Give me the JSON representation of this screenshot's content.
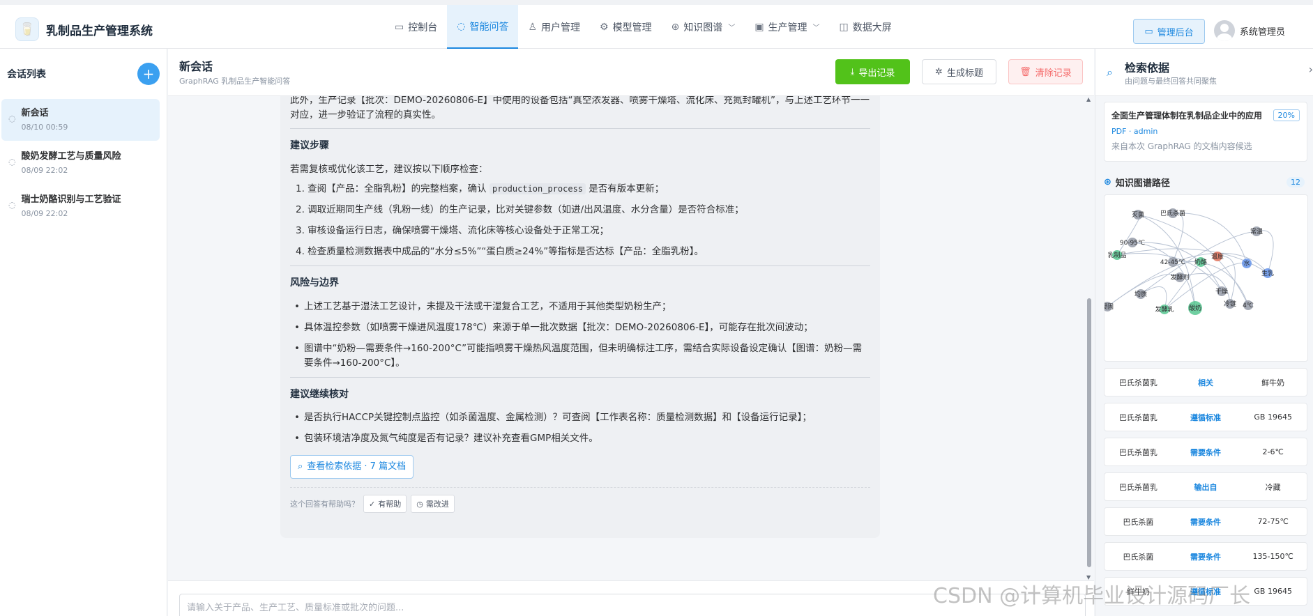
{
  "brand": {
    "name": "乳制品生产管理系统"
  },
  "nav": [
    {
      "label": "控制台",
      "icon": "monitor-icon",
      "glyph": "▭"
    },
    {
      "label": "智能问答",
      "icon": "chat-icon",
      "glyph": "◌",
      "active": true
    },
    {
      "label": "用户管理",
      "icon": "user-icon",
      "glyph": "♙"
    },
    {
      "label": "模型管理",
      "icon": "gear-icon",
      "glyph": "⚙"
    },
    {
      "label": "知识图谱",
      "icon": "graph-icon",
      "glyph": "⊛",
      "dropdown": true
    },
    {
      "label": "生产管理",
      "icon": "factory-icon",
      "glyph": "▣",
      "dropdown": true
    },
    {
      "label": "数据大屏",
      "icon": "dashboard-icon",
      "glyph": "◫"
    }
  ],
  "header": {
    "admin_label": "管理后台",
    "user_name": "系统管理员"
  },
  "sidebar": {
    "title": "会话列表",
    "add": "+",
    "sessions": [
      {
        "title": "新会话",
        "date": "08/10 00:59",
        "active": true
      },
      {
        "title": "酸奶发酵工艺与质量风险",
        "date": "08/09 22:02"
      },
      {
        "title": "瑞士奶酪识别与工艺验证",
        "date": "08/09 22:02"
      }
    ]
  },
  "main": {
    "title": "新会话",
    "subtitle": "GraphRAG 乳制品生产智能问答",
    "export_label": "导出记录",
    "gen_title_label": "生成标题",
    "clear_label": "清除记录",
    "input_placeholder": "请输入关于产品、生产工艺、质量标准或批次的问题..."
  },
  "answer": {
    "top_paragraph": "此外，生产记录【批次：DEMO-20260806-E】中使用的设备包括“真空浓发器、喷雾干燥塔、流化床、充氮封罐机”，与上述工艺环节一一对应，进一步验证了流程的真实性。",
    "sec1_title": "建议步骤",
    "sec1_intro": "若需复核或优化该工艺，建议按以下顺序检查：",
    "step1_prefix": "1. 查阅【产品：全脂乳粉】的完整档案，确认 ",
    "step1_code": "production_process",
    "step1_suffix": " 是否有版本更新；",
    "step2": "2. 调取近期同生产线（乳粉一线）的生产记录，比对关键参数（如进/出风温度、水分含量）是否符合标准；",
    "step3": "3. 审核设备运行日志，确保喷雾干燥塔、流化床等核心设备处于正常工况；",
    "step4": "4. 检查质量检测数据表中成品的“水分≤5%”“蛋白质≥24%”等指标是否达标【产品：全脂乳粉】。",
    "sec2_title": "风险与边界",
    "risk1": "上述工艺基于湿法工艺设计，未提及干法或干湿复合工艺，不适用于其他类型奶粉生产；",
    "risk2": "具体温控参数（如喷雾干燥进风温度178℃）来源于单一批次数据【批次：DEMO-20260806-E】，可能存在批次间波动；",
    "risk3": "图谱中“奶粉—需要条件→160-200°C”可能指喷雾干燥热风温度范围，但未明确标注工序，需结合实际设备设定确认【图谱：奶粉—需要条件→160-200°C】。",
    "sec3_title": "建议继续核对",
    "check1": "是否执行HACCP关键控制点监控（如杀菌温度、金属检测）？可查阅【工作表名称：质量检测数据】和【设备运行记录】；",
    "check2": "包装环境洁净度及氮气纯度是否有记录？建议补充查看GMP相关文件。",
    "source_btn": "查看检索依据 · 7 篇文档",
    "feedback_q": "这个回答有帮助吗？",
    "helpful": "有帮助",
    "improve": "需改进"
  },
  "rpanel": {
    "title": "检索依据",
    "subtitle": "由问题与最终回答共同聚焦",
    "doc_title": "全面生产管理体制在乳制品企业中的应用",
    "doc_score": "20%",
    "doc_meta": "PDF · admin",
    "doc_note": "来自本次 GraphRAG 的文档内容候选",
    "kg_title": "知识图谱路径",
    "kg_count": "12",
    "kg_nodes": [
      {
        "label": "灭菌"
      },
      {
        "label": "巴氏杀菌"
      },
      {
        "label": "常温"
      },
      {
        "label": "90-95℃"
      },
      {
        "label": "乳制品"
      },
      {
        "label": "42-45℃"
      },
      {
        "label": "奶酪"
      },
      {
        "label": "温度"
      },
      {
        "label": "水"
      },
      {
        "label": "生乳"
      },
      {
        "label": "发酵剂"
      },
      {
        "label": "均质"
      },
      {
        "label": "干燥"
      },
      {
        "label": "冷链"
      },
      {
        "label": "4℃"
      },
      {
        "label": "凝固"
      },
      {
        "label": "发酵乳"
      },
      {
        "label": "酸奶"
      }
    ],
    "relations": [
      {
        "head": "巴氏杀菌乳",
        "rel": "相关",
        "tail": "鲜牛奶"
      },
      {
        "head": "巴氏杀菌乳",
        "rel": "遵循标准",
        "tail": "GB 19645"
      },
      {
        "head": "巴氏杀菌乳",
        "rel": "需要条件",
        "tail": "2-6℃"
      },
      {
        "head": "巴氏杀菌乳",
        "rel": "输出自",
        "tail": "冷藏"
      },
      {
        "head": "巴氏杀菌",
        "rel": "需要条件",
        "tail": "72-75℃"
      },
      {
        "head": "巴氏杀菌",
        "rel": "需要条件",
        "tail": "135-150℃"
      },
      {
        "head": "鲜牛奶",
        "rel": "遵循标准",
        "tail": "GB 19645"
      }
    ]
  },
  "watermark": "CSDN @计算机毕业设计源码厂长",
  "colors": {
    "primary": "#1b87df",
    "success": "#52c21a",
    "danger": "#f56c6c"
  }
}
